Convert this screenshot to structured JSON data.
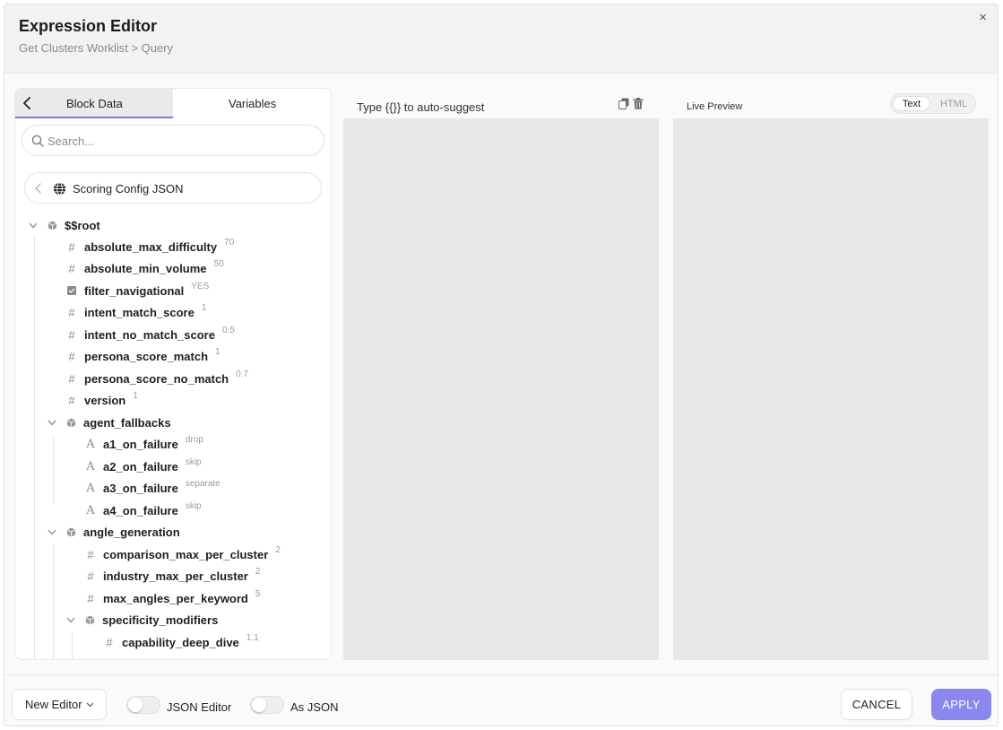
{
  "dialog": {
    "title": "Expression Editor",
    "breadcrumb": "Get Clusters Worklist > Query",
    "close": "×"
  },
  "left_panel": {
    "tabs": [
      {
        "label": "Block Data",
        "active": true
      },
      {
        "label": "Variables",
        "active": false
      }
    ],
    "search_placeholder": "Search...",
    "source": {
      "label": "Scoring Config JSON",
      "icon": "globe-icon"
    },
    "tree": {
      "root": {
        "key": "$$root",
        "icon": "cube-icon"
      },
      "root_items": [
        {
          "key": "absolute_max_difficulty",
          "value": "70",
          "type": "number"
        },
        {
          "key": "absolute_min_volume",
          "value": "50",
          "type": "number"
        },
        {
          "key": "filter_navigational",
          "value": "YES",
          "type": "boolean"
        },
        {
          "key": "intent_match_score",
          "value": "1",
          "type": "number"
        },
        {
          "key": "intent_no_match_score",
          "value": "0.5",
          "type": "number"
        },
        {
          "key": "persona_score_match",
          "value": "1",
          "type": "number"
        },
        {
          "key": "persona_score_no_match",
          "value": "0.7",
          "type": "number"
        },
        {
          "key": "version",
          "value": "1",
          "type": "number"
        }
      ],
      "agent_fallbacks": {
        "key": "agent_fallbacks",
        "items": [
          {
            "key": "a1_on_failure",
            "value": "drop",
            "type": "string"
          },
          {
            "key": "a2_on_failure",
            "value": "skip",
            "type": "string"
          },
          {
            "key": "a3_on_failure",
            "value": "separate",
            "type": "string"
          },
          {
            "key": "a4_on_failure",
            "value": "skip",
            "type": "string"
          }
        ]
      },
      "angle_generation": {
        "key": "angle_generation",
        "items": [
          {
            "key": "comparison_max_per_cluster",
            "value": "2",
            "type": "number"
          },
          {
            "key": "industry_max_per_cluster",
            "value": "2",
            "type": "number"
          },
          {
            "key": "max_angles_per_keyword",
            "value": "5",
            "type": "number"
          }
        ],
        "specificity_modifiers": {
          "key": "specificity_modifiers",
          "items": [
            {
              "key": "capability_deep_dive",
              "value": "1.1",
              "type": "number"
            }
          ]
        }
      }
    }
  },
  "editor": {
    "hint": "Type {{}} to auto-suggest"
  },
  "preview": {
    "label": "Live Preview",
    "modes": [
      "Text",
      "HTML"
    ],
    "selected_mode": "Text"
  },
  "footer": {
    "editor_select": "New Editor",
    "json_editor_label": "JSON Editor",
    "json_editor_on": false,
    "as_json_label": "As JSON",
    "as_json_on": false,
    "cancel": "CANCEL",
    "apply": "APPLY"
  },
  "colors": {
    "accent": "#8a87ee",
    "tab_underline": "#7a79e8",
    "pane_bg": "#e8e8e8"
  }
}
